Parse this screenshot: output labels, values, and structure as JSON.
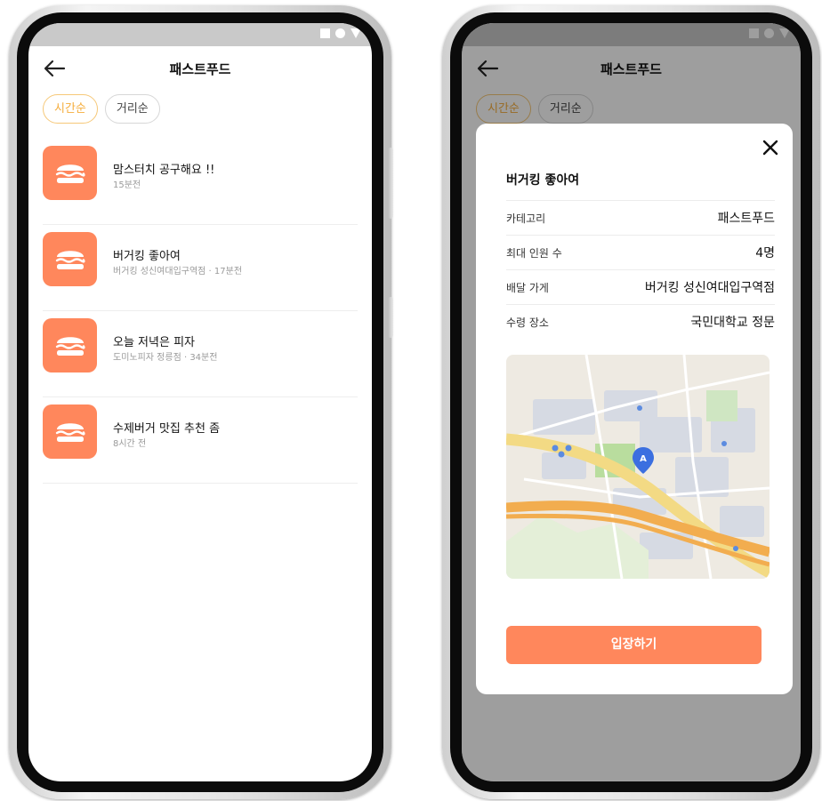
{
  "list_screen": {
    "header": {
      "title": "패스트푸드"
    },
    "sort_chips": [
      {
        "label": "시간순",
        "active": true
      },
      {
        "label": "거리순",
        "active": false
      }
    ],
    "items": [
      {
        "title": "맘스터치 공구해요 !!",
        "subtitle": "15분전",
        "icon": "burger-icon"
      },
      {
        "title": "버거킹 좋아여",
        "subtitle": "버거킹 성신여대입구역점 · 17분전",
        "icon": "burger-icon"
      },
      {
        "title": "오늘 저녁은 피자",
        "subtitle": "도미노피자 정릉점 · 34분전",
        "icon": "burger-icon"
      },
      {
        "title": "수제버거 맛집 추천 좀",
        "subtitle": "8시간 전",
        "icon": "burger-icon"
      }
    ]
  },
  "detail_screen": {
    "header": {
      "title": "패스트푸드"
    },
    "sort_chips": [
      {
        "label": "시간순",
        "active": true
      },
      {
        "label": "거리순",
        "active": false
      }
    ],
    "modal": {
      "title": "버거킹 좋아여",
      "rows": [
        {
          "key": "카테고리",
          "value": "패스트푸드"
        },
        {
          "key": "최대 인원 수",
          "value": "4명"
        },
        {
          "key": "배달 가게",
          "value": "버거킹 성신여대입구역점"
        },
        {
          "key": "수령 장소",
          "value": "국민대학교 정문"
        }
      ],
      "map": {
        "marker_label": "A",
        "icon": "map-pin-icon"
      },
      "enter_button": "입장하기"
    }
  },
  "colors": {
    "accent_orange": "#ff875c",
    "chip_active": "#f5ad3c",
    "statusbar": "#c9c9c9"
  }
}
